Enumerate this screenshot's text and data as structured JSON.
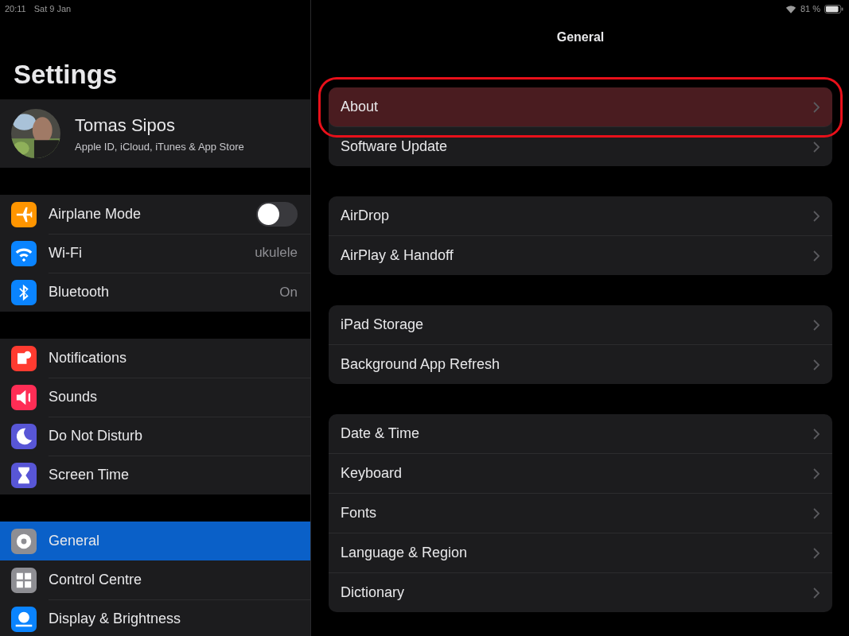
{
  "status_bar": {
    "time": "20:11",
    "date": "Sat 9 Jan",
    "battery": "81 %"
  },
  "sidebar": {
    "title": "Settings",
    "profile": {
      "name": "Tomas Sipos",
      "subtitle": "Apple ID, iCloud, iTunes & App Store"
    },
    "groups": [
      [
        {
          "label": "Airplane Mode",
          "color": "#ff9500",
          "kind": "toggle",
          "on": false,
          "selected": false
        },
        {
          "label": "Wi-Fi",
          "color": "#0a84ff",
          "kind": "value",
          "value": "ukulele",
          "selected": false
        },
        {
          "label": "Bluetooth",
          "color": "#0a84ff",
          "kind": "value",
          "value": "On",
          "selected": false
        }
      ],
      [
        {
          "label": "Notifications",
          "color": "#ff3b30",
          "kind": "link",
          "selected": false
        },
        {
          "label": "Sounds",
          "color": "#ff2d55",
          "kind": "link",
          "selected": false
        },
        {
          "label": "Do Not Disturb",
          "color": "#5856d6",
          "kind": "link",
          "selected": false
        },
        {
          "label": "Screen Time",
          "color": "#5856d6",
          "kind": "link",
          "selected": false
        }
      ],
      [
        {
          "label": "General",
          "color": "#8e8e93",
          "kind": "link",
          "selected": true
        },
        {
          "label": "Control Centre",
          "color": "#8e8e93",
          "kind": "link",
          "selected": false
        },
        {
          "label": "Display & Brightness",
          "color": "#0a84ff",
          "kind": "link",
          "selected": false
        }
      ]
    ]
  },
  "detail": {
    "title": "General",
    "groups": [
      [
        {
          "label": "About",
          "highlighted": true
        },
        {
          "label": "Software Update",
          "highlighted": false
        }
      ],
      [
        {
          "label": "AirDrop",
          "highlighted": false
        },
        {
          "label": "AirPlay & Handoff",
          "highlighted": false
        }
      ],
      [
        {
          "label": "iPad Storage",
          "highlighted": false
        },
        {
          "label": "Background App Refresh",
          "highlighted": false
        }
      ],
      [
        {
          "label": "Date & Time",
          "highlighted": false
        },
        {
          "label": "Keyboard",
          "highlighted": false
        },
        {
          "label": "Fonts",
          "highlighted": false
        },
        {
          "label": "Language & Region",
          "highlighted": false
        },
        {
          "label": "Dictionary",
          "highlighted": false
        }
      ]
    ]
  }
}
